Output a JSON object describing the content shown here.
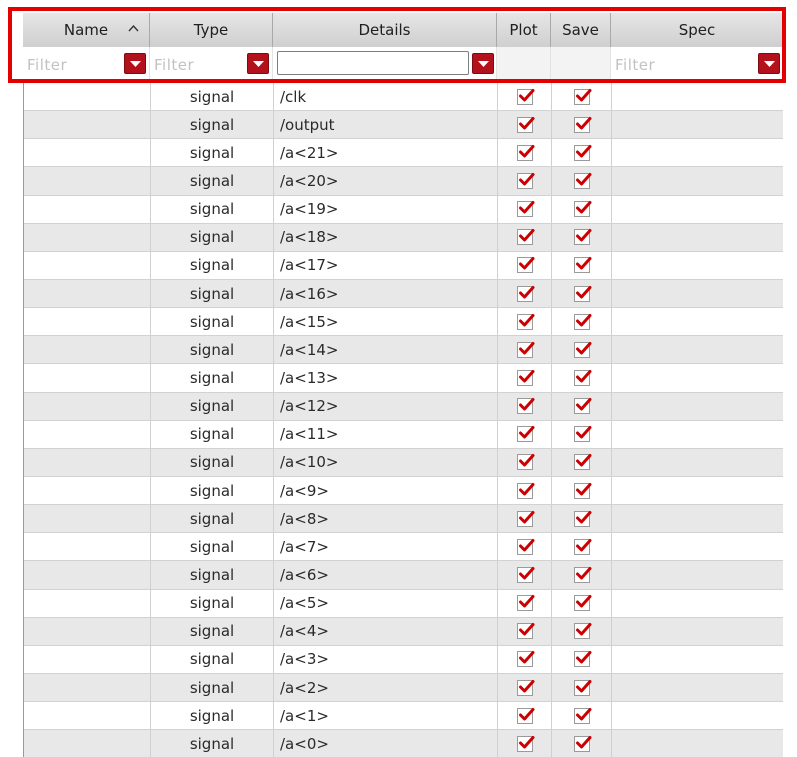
{
  "columns": {
    "name": "Name",
    "type": "Type",
    "details": "Details",
    "plot": "Plot",
    "save": "Save",
    "spec": "Spec"
  },
  "filters": {
    "name_placeholder": "Filter",
    "type_placeholder": "Filter",
    "details_value": "",
    "spec_placeholder": "Filter"
  },
  "colors": {
    "highlight": "#e30000",
    "dropdown": "#b3121d",
    "check": "#cc0000"
  },
  "icons": {
    "sort": "sort-ascending-icon",
    "dropdown": "chevron-down-icon",
    "check": "check-icon"
  },
  "rows": [
    {
      "name": "",
      "type": "signal",
      "details": "/clk",
      "plot": true,
      "save": true,
      "spec": ""
    },
    {
      "name": "",
      "type": "signal",
      "details": "/output",
      "plot": true,
      "save": true,
      "spec": ""
    },
    {
      "name": "",
      "type": "signal",
      "details": "/a<21>",
      "plot": true,
      "save": true,
      "spec": ""
    },
    {
      "name": "",
      "type": "signal",
      "details": "/a<20>",
      "plot": true,
      "save": true,
      "spec": ""
    },
    {
      "name": "",
      "type": "signal",
      "details": "/a<19>",
      "plot": true,
      "save": true,
      "spec": ""
    },
    {
      "name": "",
      "type": "signal",
      "details": "/a<18>",
      "plot": true,
      "save": true,
      "spec": ""
    },
    {
      "name": "",
      "type": "signal",
      "details": "/a<17>",
      "plot": true,
      "save": true,
      "spec": ""
    },
    {
      "name": "",
      "type": "signal",
      "details": "/a<16>",
      "plot": true,
      "save": true,
      "spec": ""
    },
    {
      "name": "",
      "type": "signal",
      "details": "/a<15>",
      "plot": true,
      "save": true,
      "spec": ""
    },
    {
      "name": "",
      "type": "signal",
      "details": "/a<14>",
      "plot": true,
      "save": true,
      "spec": ""
    },
    {
      "name": "",
      "type": "signal",
      "details": "/a<13>",
      "plot": true,
      "save": true,
      "spec": ""
    },
    {
      "name": "",
      "type": "signal",
      "details": "/a<12>",
      "plot": true,
      "save": true,
      "spec": ""
    },
    {
      "name": "",
      "type": "signal",
      "details": "/a<11>",
      "plot": true,
      "save": true,
      "spec": ""
    },
    {
      "name": "",
      "type": "signal",
      "details": "/a<10>",
      "plot": true,
      "save": true,
      "spec": ""
    },
    {
      "name": "",
      "type": "signal",
      "details": "/a<9>",
      "plot": true,
      "save": true,
      "spec": ""
    },
    {
      "name": "",
      "type": "signal",
      "details": "/a<8>",
      "plot": true,
      "save": true,
      "spec": ""
    },
    {
      "name": "",
      "type": "signal",
      "details": "/a<7>",
      "plot": true,
      "save": true,
      "spec": ""
    },
    {
      "name": "",
      "type": "signal",
      "details": "/a<6>",
      "plot": true,
      "save": true,
      "spec": ""
    },
    {
      "name": "",
      "type": "signal",
      "details": "/a<5>",
      "plot": true,
      "save": true,
      "spec": ""
    },
    {
      "name": "",
      "type": "signal",
      "details": "/a<4>",
      "plot": true,
      "save": true,
      "spec": ""
    },
    {
      "name": "",
      "type": "signal",
      "details": "/a<3>",
      "plot": true,
      "save": true,
      "spec": ""
    },
    {
      "name": "",
      "type": "signal",
      "details": "/a<2>",
      "plot": true,
      "save": true,
      "spec": ""
    },
    {
      "name": "",
      "type": "signal",
      "details": "/a<1>",
      "plot": true,
      "save": true,
      "spec": ""
    },
    {
      "name": "",
      "type": "signal",
      "details": "/a<0>",
      "plot": true,
      "save": true,
      "spec": ""
    }
  ]
}
